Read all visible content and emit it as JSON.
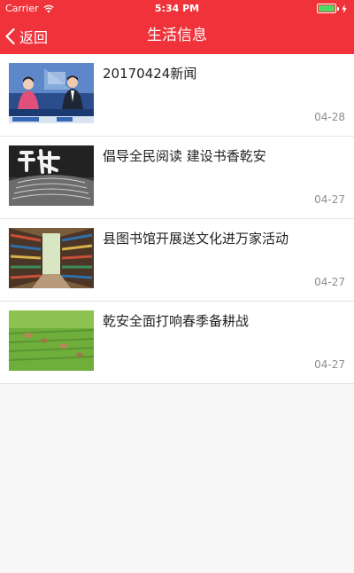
{
  "status_bar": {
    "carrier": "Carrier",
    "time": "5:34 PM",
    "wifi_icon": "wifi-icon",
    "battery_icon": "battery-icon",
    "battery_color": "#4cd964"
  },
  "nav": {
    "back_label": "返回",
    "title": "生活信息",
    "background_color": "#f0333a"
  },
  "list": {
    "items": [
      {
        "title": "20170424新闻",
        "date": "04-28",
        "thumb": "news-broadcast-image"
      },
      {
        "title": "倡导全民阅读 建设书香乾安",
        "date": "04-27",
        "thumb": "reading-image"
      },
      {
        "title": "县图书馆开展送文化进万家活动",
        "date": "04-27",
        "thumb": "library-shelves-image"
      },
      {
        "title": "乾安全面打响春季备耕战",
        "date": "04-27",
        "thumb": "farmland-image"
      }
    ]
  }
}
